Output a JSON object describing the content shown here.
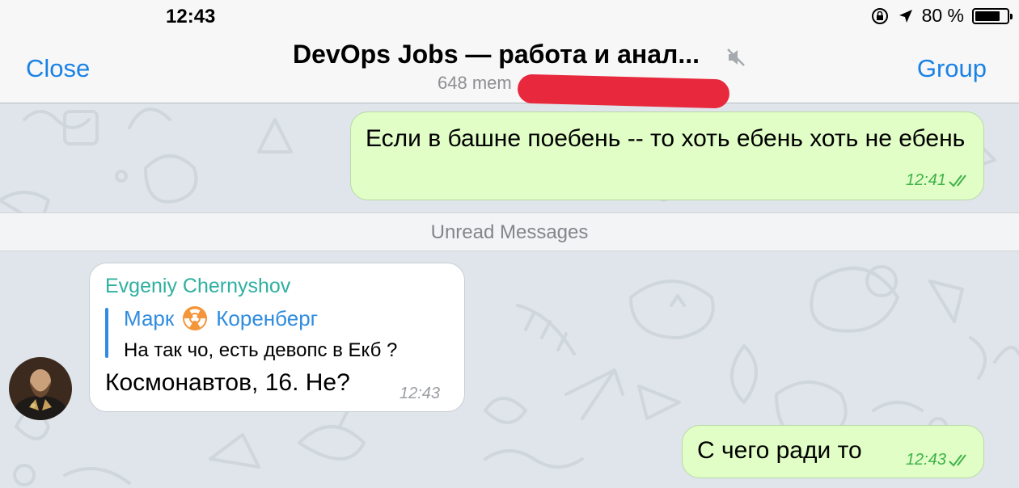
{
  "status_bar": {
    "time": "12:43",
    "battery_text": "80 %",
    "battery_level": 0.8
  },
  "nav": {
    "close_label": "Close",
    "title": "DevOps Jobs — работа и анал...",
    "subtitle": "648 mem",
    "group_label": "Group",
    "mute_icon": "muted-speaker-icon"
  },
  "messages": [
    {
      "direction": "outgoing",
      "text": "Если в башне поебень -- то хоть ебень хоть не ебень",
      "time": "12:41",
      "read": true
    },
    {
      "direction": "incoming",
      "sender": "Evgeniy Chernyshov",
      "reply_author_first": "Марк",
      "reply_author_last": "Коренберг",
      "reply_author_icon": "radioactive-icon",
      "reply_text": "На так чо, есть девопс в Екб ?",
      "text": "Космонавтов, 16. Не?",
      "time": "12:43"
    },
    {
      "direction": "outgoing",
      "text": "С чего ради то",
      "time": "12:43",
      "read": true
    }
  ],
  "unread_label": "Unread Messages",
  "colors": {
    "accent": "#1a82e6",
    "outgoing_bubble": "#e1fec6",
    "check": "#3fb24a",
    "sender": "#2fb0a0",
    "redaction": "#e8283c"
  }
}
